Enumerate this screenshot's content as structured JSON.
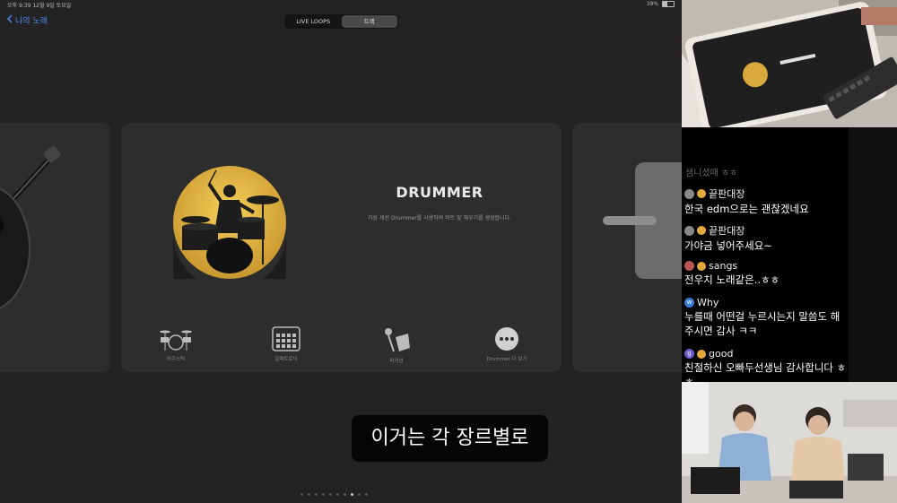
{
  "status_bar": {
    "time": "오후 9:39   12월 9일 토요일",
    "battery": "39%",
    "battery_level": 0.39
  },
  "nav": {
    "back_label": "나의 노래"
  },
  "segmented": {
    "tabs": [
      {
        "label": "LIVE LOOPS",
        "active": false
      },
      {
        "label": "트랙",
        "active": true
      }
    ]
  },
  "main_card": {
    "title": "DRUMMER",
    "description": "가상 세션 Drummer를 사용하여 비트 및 채우기를 생성합니다.",
    "bottom_items": [
      {
        "label": "어쿠스틱",
        "icon": "drum-kit-icon"
      },
      {
        "label": "일렉트로닉",
        "icon": "drum-machine-icon"
      },
      {
        "label": "퍼커션",
        "icon": "percussion-icon"
      },
      {
        "label": "Drummer 더 보기",
        "icon": "more-icon"
      }
    ]
  },
  "subtitle": "이거는 각 장르별로",
  "page_dots": {
    "count": 10,
    "active_index": 7
  },
  "chat": {
    "partial_text": "샘니셨때 ㅎㅎ",
    "messages": [
      {
        "user": "끝판대장",
        "text": "한국 edm으로는 괜찮겠네요"
      },
      {
        "user": "끝판대장",
        "text": "가야금 넣어주세요~"
      },
      {
        "user": "sangs",
        "text": "전우치 노래같은..ㅎㅎ"
      },
      {
        "user": "Why",
        "text": "누를때 어떤걸 누르시는지 말씀도 해주시면 감사 ㅋㅋ"
      },
      {
        "user": "good",
        "text": "친절하신 오빠두선생님 감사합니다 ㅎㅎ"
      }
    ]
  },
  "colors": {
    "accent": "#4a8ef0",
    "drummer_gold": "#e6bb45",
    "badge": "#e3a93b"
  }
}
